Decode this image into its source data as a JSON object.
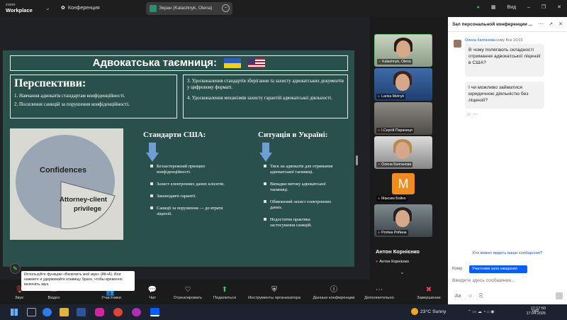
{
  "titlebar": {
    "logo_top": "zoom",
    "logo_bottom": "Workplace",
    "meeting_label": "Конференция",
    "share_label": "Экран (Kalashnyk, Olena)",
    "view_label": "Вид"
  },
  "slide": {
    "title": "Адвокатська таємниця:",
    "perspectives_heading": "Перспективи:",
    "perspectives": [
      "1. Навчання адвокатів стандартам конфіденційності.",
      "2. Посилення санкцій за порушення конфіденційності."
    ],
    "right_items": [
      "3. Удосконалення стандартів зберігання та захисту адвокатських документів у цифровому форматі.",
      "4. Удосконалення механізмів захисту гарантій адвокатської діяльності."
    ],
    "chart_labels": {
      "top": "Confidences",
      "bottom": "Attorney-client privilege"
    },
    "usa_heading": "Стандарти США:",
    "usa_items": [
      "Беззастережний принцип конфіденційності.",
      "Захист електронних даних клієнтів.",
      "Законодавчі гарантії.",
      "Санкції за порушення — до втрати ліцензії."
    ],
    "ua_heading": "Ситуація в Україні:",
    "ua_items": [
      "Тиск на адвокатів для отримання адвокатської таємниці.",
      "Випадки витоку адвокатської таємниці.",
      "Обмежений захист електронних даних.",
      "Недостатня практика застосування санкцій."
    ]
  },
  "participants": [
    "Kalashnyk, Olena",
    "Larisa Melnyk",
    "І.Сергій Параниця",
    "Олена Калганова",
    "Максим Бойко",
    "Poліна Рябина"
  ],
  "avatar_letter": "M",
  "active_speaker": {
    "name": "Антон Корнієнко",
    "label": "Антон Корнієнко"
  },
  "chat": {
    "title": "Зал персональной конференции ...",
    "sender": "Олена Калганова",
    "to": "кому Все",
    "time": "16:03",
    "messages": [
      "В чому полягають складності отримання адвокатської ліцензії в США?",
      "І чи можливо займатися юридичною діяльністю без ліцензії?"
    ],
    "who_sees": "Кто может видеть ваши сообщения?",
    "to_label": "Кому:",
    "to_value": "Участники зала ожидания",
    "input_placeholder": "Введите здесь сообщение..."
  },
  "toolbar": {
    "items": [
      "Звук",
      "Видео",
      "Участники",
      "Чат",
      "Отреагировать",
      "Поделиться",
      "Инструменты организатора",
      "Данные конференции",
      "Дополнительно",
      "Завершение"
    ],
    "participants_count": "7",
    "tooltip": "Используйте функцию «Включить мой звук» (Alt+A). Или нажмите и удерживайте клавишу Space, чтобы временно включить звук."
  },
  "taskbar": {
    "weather_temp": "23°C",
    "weather_text": "Sunny",
    "lang": "УКР",
    "time": "17:17:50",
    "date": "17.04.2025"
  },
  "colors": {
    "slide_bg": "#29504a",
    "accent": "#0b5cff",
    "end": "#e54848"
  }
}
